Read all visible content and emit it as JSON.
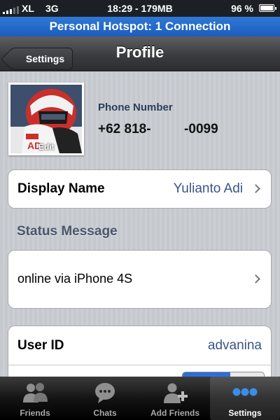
{
  "status_bar": {
    "carrier": "XL",
    "network": "3G",
    "time_memory": "18:29 - 179MB",
    "battery": "96 %"
  },
  "hotspot": {
    "text": "Personal Hotspot: 1 Connection"
  },
  "nav": {
    "back_label": "Settings",
    "title": "Profile"
  },
  "profile": {
    "avatar_edit_label": "Edit",
    "phone_label": "Phone Number",
    "phone_value": "+62 818-         -0099"
  },
  "display_name": {
    "label": "Display Name",
    "value": "Yulianto Adi"
  },
  "status_message": {
    "header": "Status Message",
    "value": "online via iPhone 4S"
  },
  "user_id": {
    "label": "User ID",
    "value": "advanina"
  },
  "tabs": [
    {
      "label": "Friends",
      "icon": "friends-icon",
      "active": false
    },
    {
      "label": "Chats",
      "icon": "chats-icon",
      "active": false
    },
    {
      "label": "Add Friends",
      "icon": "add-friends-icon",
      "active": false
    },
    {
      "label": "Settings",
      "icon": "settings-icon",
      "active": true
    }
  ],
  "colors": {
    "hotspot": "#1d5cbd",
    "link_value": "#385487",
    "active_tab_icon": "#3a8de8"
  }
}
